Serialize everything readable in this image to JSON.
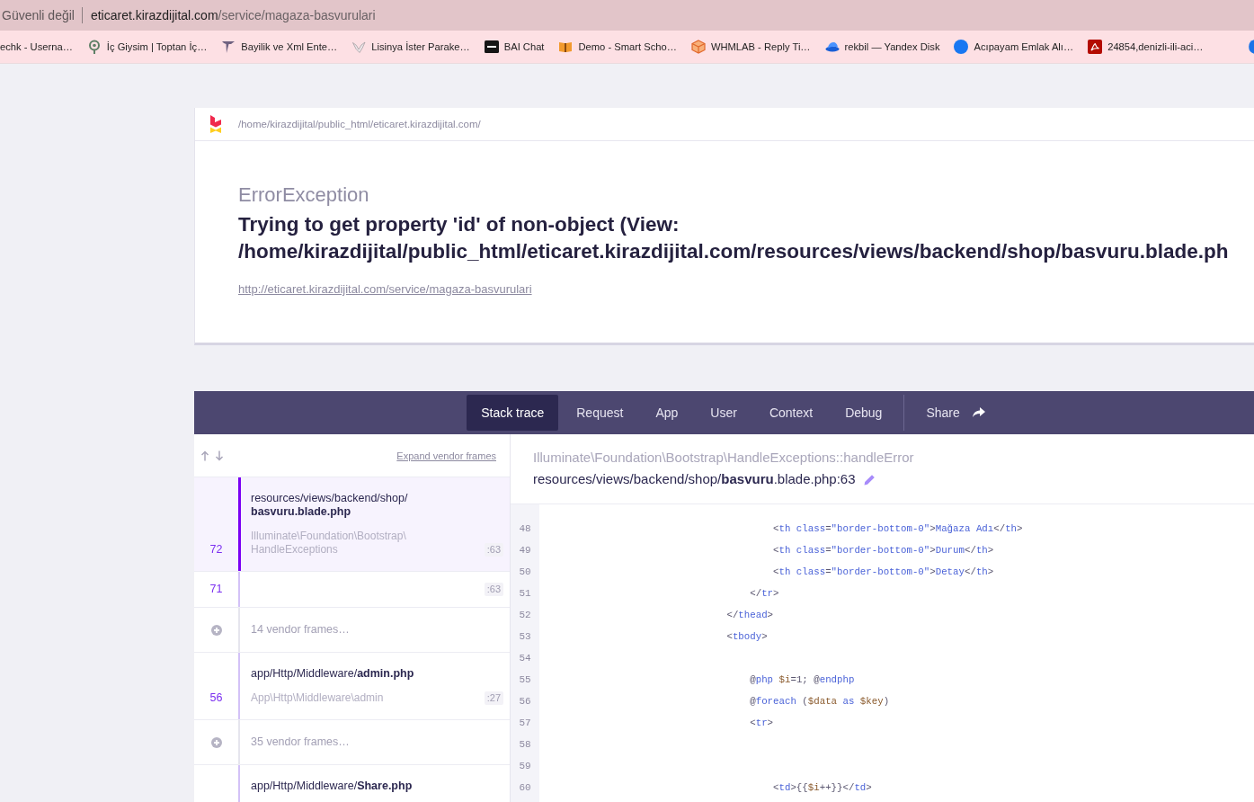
{
  "browser": {
    "security_label": "Güvenli değil",
    "url": "eticaret.kirazdijital.com/service/magaza-basvurulari"
  },
  "bookmarks": [
    {
      "title": "echk - Userna…"
    },
    {
      "title": "İç Giysim | Toptan İç…"
    },
    {
      "title": "Bayilik ve Xml Ente…"
    },
    {
      "title": "Lisinya İster Parake…"
    },
    {
      "title": "BAI Chat"
    },
    {
      "title": "Demo - Smart Scho…"
    },
    {
      "title": "WHMLAB - Reply Ti…"
    },
    {
      "title": "rekbil — Yandex Disk"
    },
    {
      "title": "Acıpayam Emlak Alı…"
    },
    {
      "title": "24854,denizli-ili-aci…"
    }
  ],
  "header": {
    "path": "/home/kirazdijital/public_html/eticaret.kirazdijital.com/"
  },
  "error": {
    "type": "ErrorException",
    "message": "Trying to get property 'id' of non-object (View: /home/kirazdijital/public_html/eticaret.kirazdijital.com/resources/views/backend/shop/basvuru.blade.ph",
    "url": "http://eticaret.kirazdijital.com/service/magaza-basvurulari"
  },
  "tabs": [
    {
      "label": "Stack trace",
      "selected": true
    },
    {
      "label": "Request",
      "selected": false
    },
    {
      "label": "App",
      "selected": false
    },
    {
      "label": "User",
      "selected": false
    },
    {
      "label": "Context",
      "selected": false
    },
    {
      "label": "Debug",
      "selected": false
    }
  ],
  "share": {
    "label": "Share"
  },
  "stack": {
    "expand_link": "Expand vendor frames",
    "frames": [
      {
        "kind": "app",
        "selected": true,
        "number": "72",
        "file": "resources/views/backend/shop/**basvuru.blade.php**",
        "class": "Illuminate\\Foundation\\Bootstrap\\HandleExceptions",
        "line": ":63"
      },
      {
        "kind": "app",
        "selected": false,
        "number": "71",
        "line": ":63"
      },
      {
        "kind": "vendor",
        "selected": false,
        "label": "14 vendor frames…"
      },
      {
        "kind": "app",
        "selected": false,
        "number": "56",
        "file": "app/Http/Middleware/**admin.php**",
        "class": "App\\Http\\Middleware\\admin",
        "line": ":27"
      },
      {
        "kind": "vendor",
        "selected": false,
        "label": "35 vendor frames…"
      },
      {
        "kind": "app",
        "selected": false,
        "file": "app/Http/Middleware/**Share.php**"
      }
    ]
  },
  "frame_detail": {
    "class": "Illuminate\\Foundation\\Bootstrap\\HandleExceptions::handleError",
    "file": "resources/views/backend/shop/**basvuru**.blade.php:63",
    "code": [
      {
        "number": "48",
        "code": "                                        <th class=\"border-bottom-0\">Mağaza Adı</th>"
      },
      {
        "number": "49",
        "code": "                                        <th class=\"border-bottom-0\">Durum</th>"
      },
      {
        "number": "50",
        "code": "                                        <th class=\"border-bottom-0\">Detay</th>"
      },
      {
        "number": "51",
        "code": "                                    </tr>"
      },
      {
        "number": "52",
        "code": "                                </thead>"
      },
      {
        "number": "53",
        "code": "                                <tbody>"
      },
      {
        "number": "54"
      },
      {
        "number": "55",
        "code": "                                    @php $i=1; @endphp"
      },
      {
        "number": "56",
        "code": "                                    @foreach ($data as $key)"
      },
      {
        "number": "57",
        "code": "                                    <tr>"
      },
      {
        "number": "58"
      },
      {
        "number": "59"
      },
      {
        "number": "60",
        "code": "                                        <td>{{$i++}}</td>"
      }
    ]
  }
}
